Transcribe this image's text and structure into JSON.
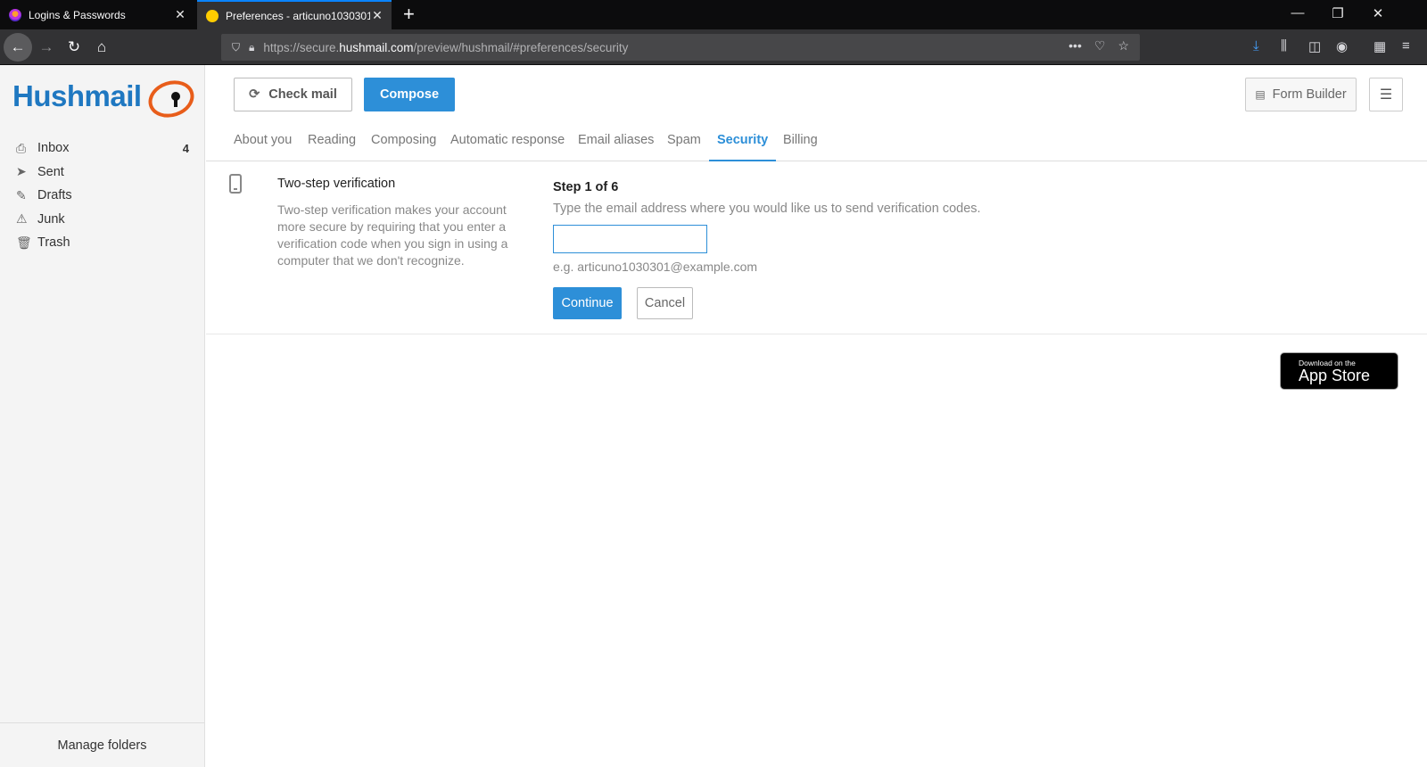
{
  "browser": {
    "tabs": [
      {
        "title": "Logins & Passwords"
      },
      {
        "title": "Preferences - articuno1030301@"
      }
    ],
    "url": {
      "prefix": "https://secure.",
      "host": "hushmail.com",
      "path": "/preview/hushmail/#preferences/security"
    }
  },
  "sidebar": {
    "logo_text": "Hushmail",
    "folders": [
      {
        "label": "Inbox",
        "count": "4"
      },
      {
        "label": "Sent",
        "count": ""
      },
      {
        "label": "Drafts",
        "count": ""
      },
      {
        "label": "Junk",
        "count": ""
      },
      {
        "label": "Trash",
        "count": ""
      }
    ],
    "manage_label": "Manage folders"
  },
  "toolbar": {
    "check_mail": "Check mail",
    "compose": "Compose",
    "form_builder": "Form Builder"
  },
  "pref_tabs": [
    {
      "label": "About you"
    },
    {
      "label": "Reading"
    },
    {
      "label": "Composing"
    },
    {
      "label": "Automatic response"
    },
    {
      "label": "Email aliases"
    },
    {
      "label": "Spam"
    },
    {
      "label": "Security"
    },
    {
      "label": "Billing"
    }
  ],
  "security": {
    "title": "Two-step verification",
    "description": "Two-step verification makes your account more secure by requiring that you enter a verification code when you sign in using a computer that we don't recognize.",
    "step": "Step 1 of 6",
    "step_desc": "Type the email address where you would like us to send verification codes.",
    "email_value": "",
    "hint": "e.g. articuno1030301@example.com",
    "continue": "Continue",
    "cancel": "Cancel"
  },
  "appstore": {
    "small": "Download on the",
    "big": "App Store"
  },
  "colors": {
    "accent": "#2d8fd8",
    "logo_orange": "#e85d1a"
  }
}
